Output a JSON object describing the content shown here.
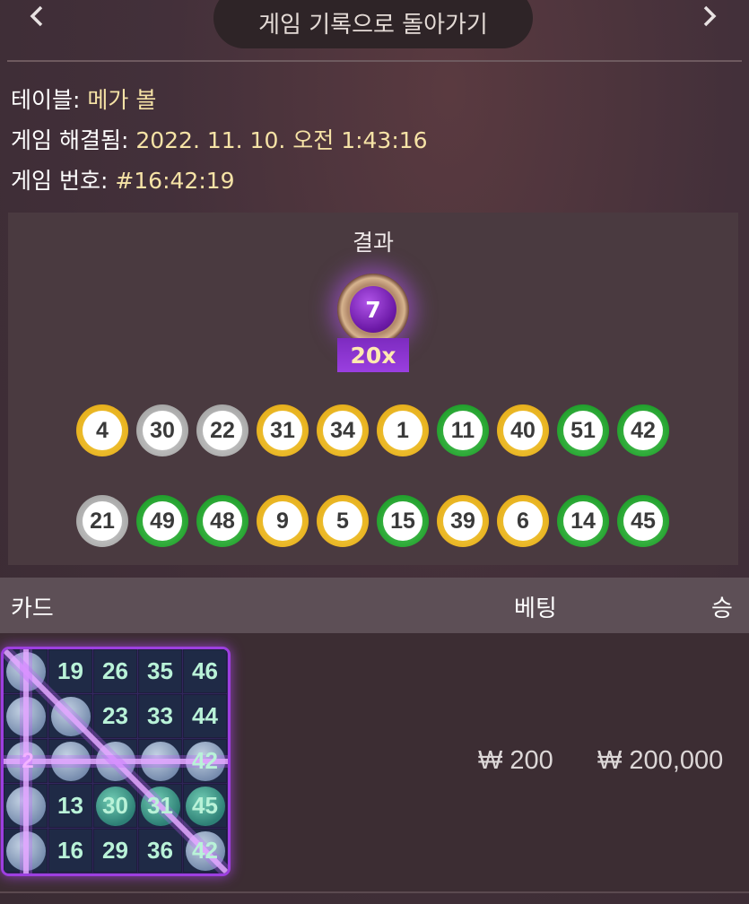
{
  "nav": {
    "back_label": "게임 기록으로 돌아가기",
    "prev_icon": "chevron-left-icon",
    "next_icon": "chevron-right-icon"
  },
  "info": {
    "table_label": "테이블:",
    "table_value": "메가 볼",
    "resolved_label": "게임 해결됨:",
    "resolved_value": "2022. 11. 10. 오전 1:43:16",
    "game_no_label": "게임 번호:",
    "game_no_value": "#16:42:19"
  },
  "result": {
    "title": "결과",
    "mega_ball": "7",
    "multiplier": "20x",
    "balls_row1": [
      {
        "n": "4",
        "color": "yellow"
      },
      {
        "n": "30",
        "color": "white"
      },
      {
        "n": "22",
        "color": "white"
      },
      {
        "n": "31",
        "color": "yellow"
      },
      {
        "n": "34",
        "color": "yellow"
      },
      {
        "n": "1",
        "color": "yellow"
      },
      {
        "n": "11",
        "color": "green"
      },
      {
        "n": "40",
        "color": "yellow"
      },
      {
        "n": "51",
        "color": "green"
      },
      {
        "n": "42",
        "color": "green"
      }
    ],
    "balls_row2": [
      {
        "n": "21",
        "color": "white"
      },
      {
        "n": "49",
        "color": "green"
      },
      {
        "n": "48",
        "color": "green"
      },
      {
        "n": "9",
        "color": "yellow"
      },
      {
        "n": "5",
        "color": "yellow"
      },
      {
        "n": "15",
        "color": "green"
      },
      {
        "n": "39",
        "color": "yellow"
      },
      {
        "n": "6",
        "color": "yellow"
      },
      {
        "n": "14",
        "color": "green"
      },
      {
        "n": "45",
        "color": "green"
      }
    ]
  },
  "table": {
    "col_card": "카드",
    "col_bet": "베팅",
    "col_win": "승",
    "rows": [
      {
        "bet": "₩ 200",
        "win": "₩ 200,000",
        "card_multiplier": "2",
        "card": [
          [
            "",
            "19",
            "26",
            "35",
            "46"
          ],
          [
            "",
            "",
            "23",
            "33",
            "44"
          ],
          [
            "",
            "",
            "",
            "",
            "42"
          ],
          [
            "",
            "13",
            "30",
            "31",
            "45"
          ],
          [
            "",
            "16",
            "29",
            "36",
            "42"
          ]
        ],
        "hits": [
          [
            1,
            0,
            0,
            0,
            0
          ],
          [
            1,
            1,
            0,
            0,
            0
          ],
          [
            1,
            1,
            1,
            1,
            1
          ],
          [
            1,
            0,
            1,
            1,
            1
          ],
          [
            1,
            0,
            0,
            0,
            1
          ]
        ]
      }
    ]
  },
  "colors": {
    "accent_purple": "#9d3fe0",
    "ball_yellow": "#e7b11e",
    "ball_green": "#23a12e",
    "ball_white": "#a9a9a9",
    "info_value": "#f6e3a6"
  }
}
